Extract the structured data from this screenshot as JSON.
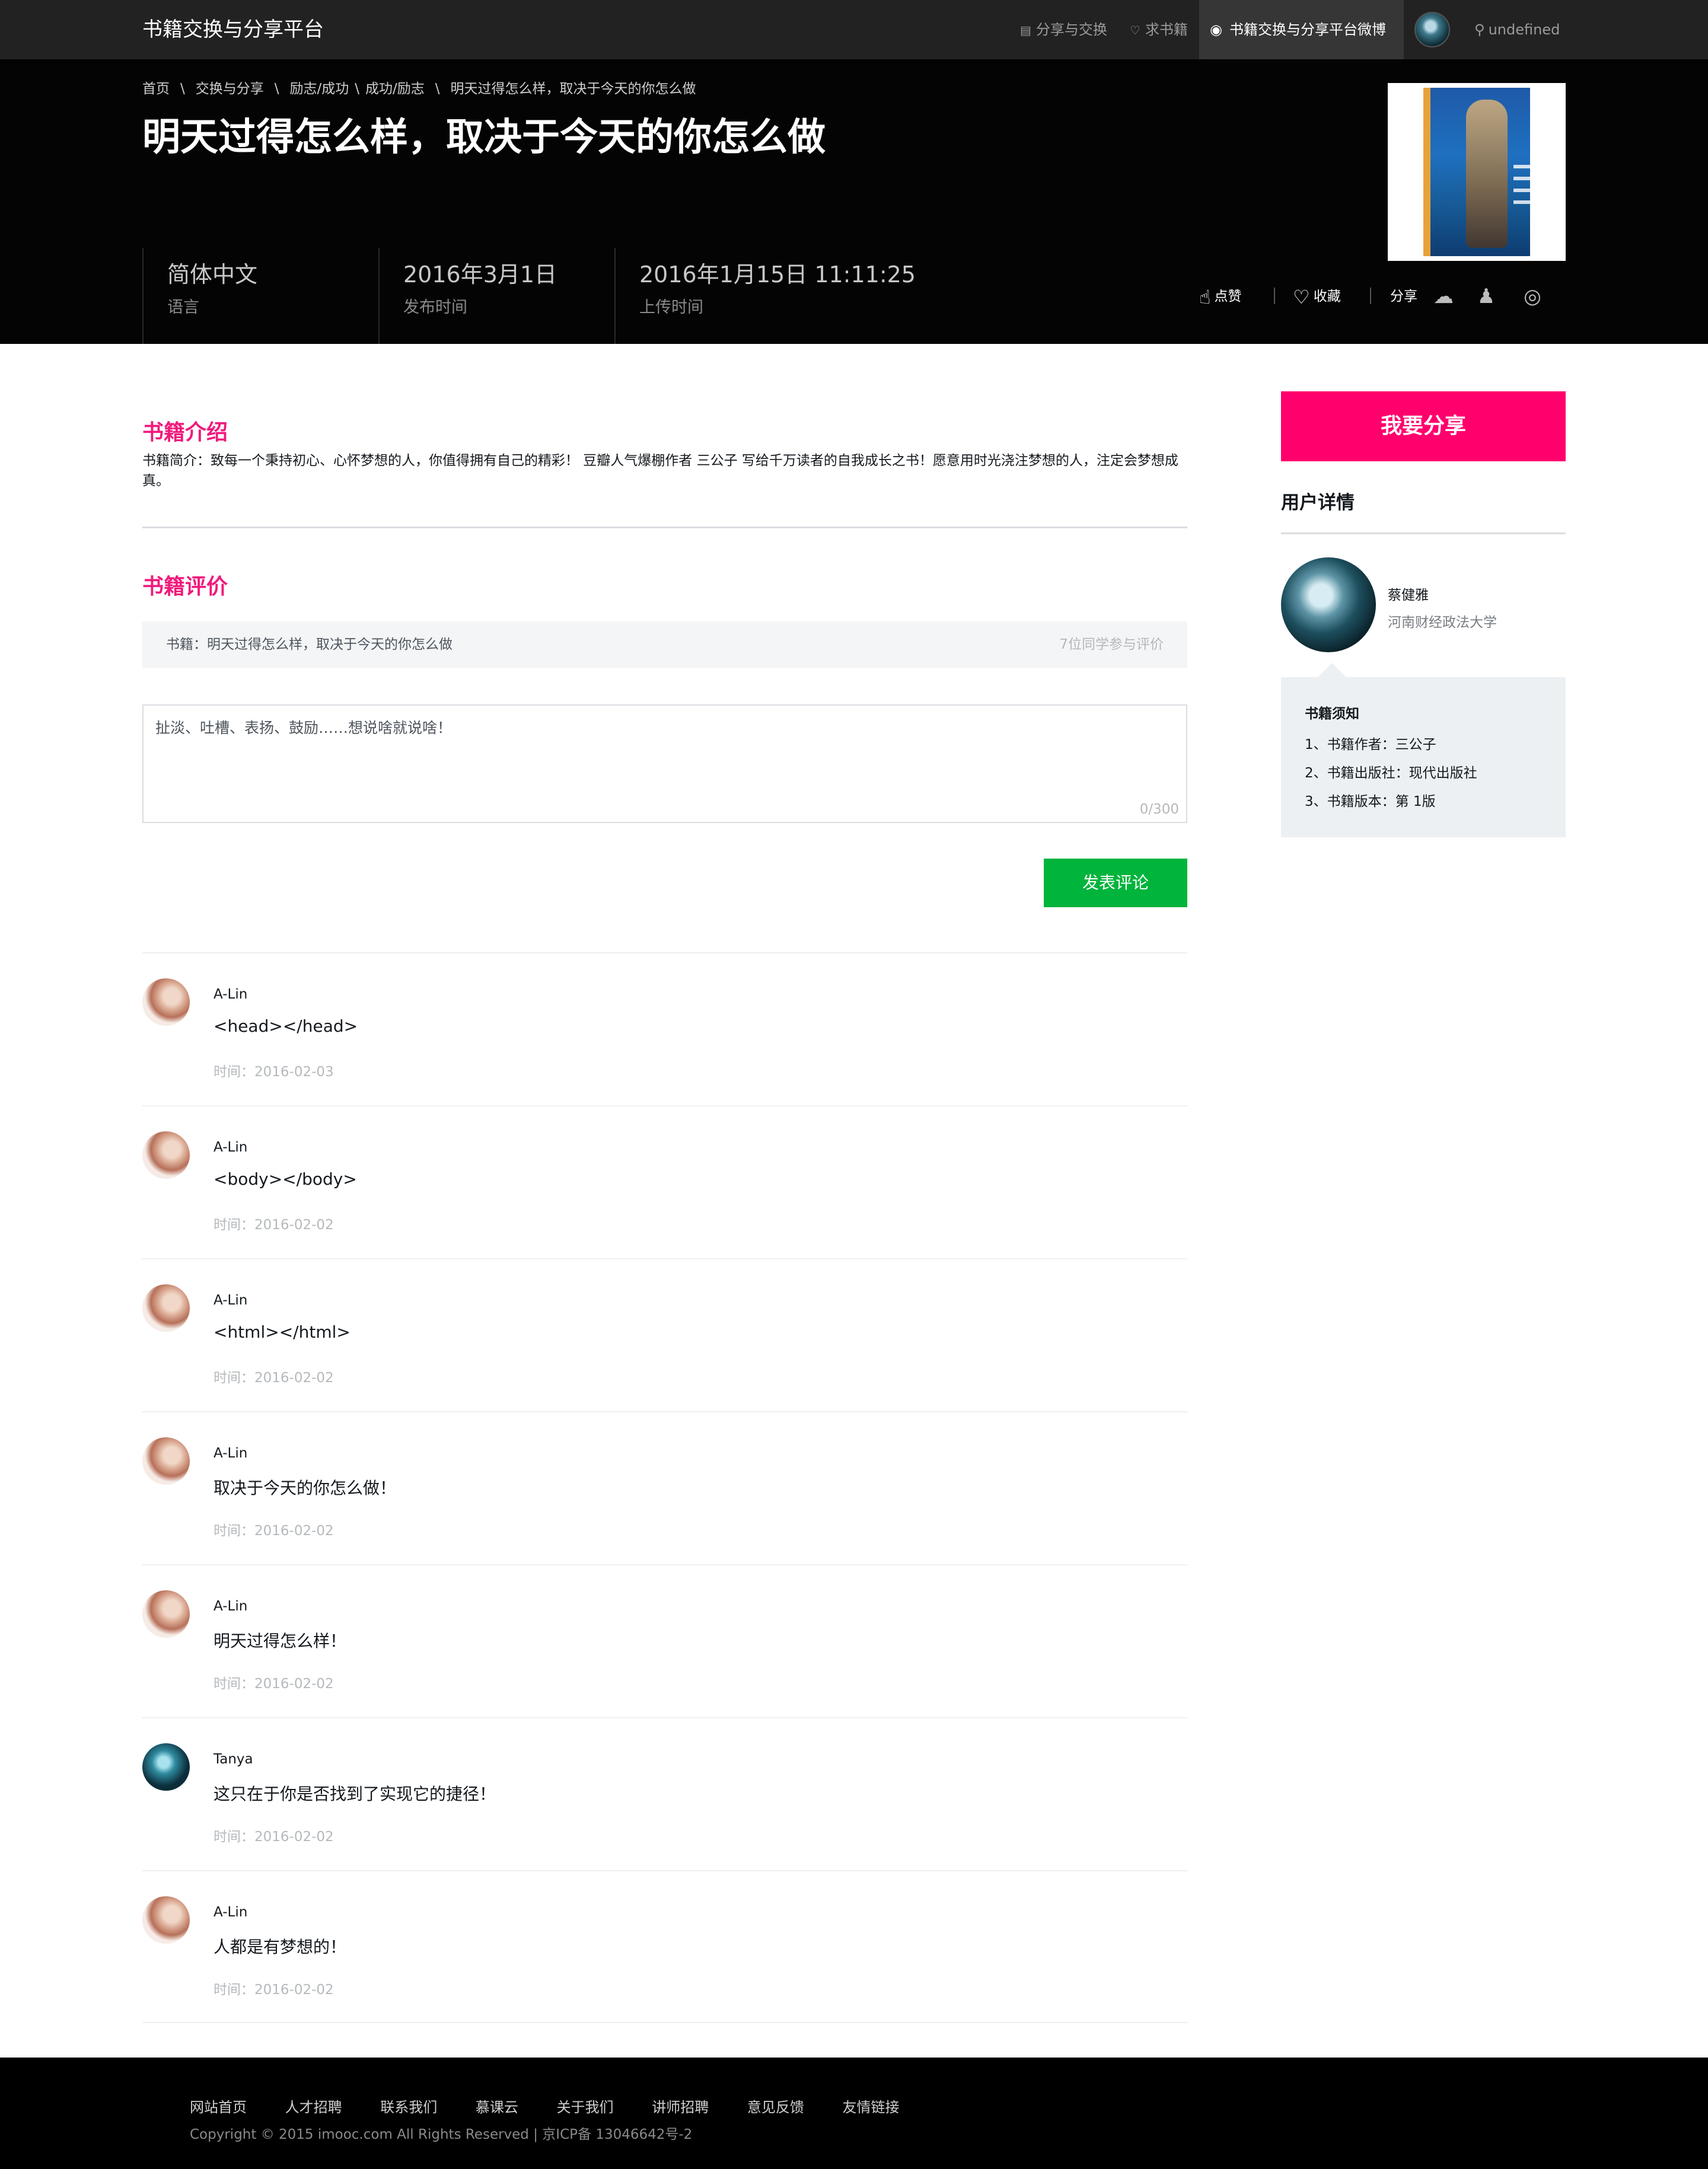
{
  "nav": {
    "brand": "书籍交换与分享平台",
    "links": [
      "分享与交换",
      "求书籍"
    ],
    "weibo": "书籍交换与分享平台微博",
    "location": "undefined"
  },
  "header": {
    "breadcrumbs": [
      "首页",
      "交换与分享",
      "励志/成功",
      "成功/励志",
      "明天过得怎么样，取决于今天的你怎么做"
    ],
    "title": "明天过得怎么样，取决于今天的你怎么做",
    "meta": [
      {
        "value": "简体中文",
        "label": "语言"
      },
      {
        "value": "2016年3月1日",
        "label": "发布时间"
      },
      {
        "value": "2016年1月15日 11:11:25",
        "label": "上传时间"
      }
    ],
    "actions": {
      "like": "点赞",
      "favorite": "收藏",
      "share": "分享"
    }
  },
  "intro": {
    "title": "书籍介绍",
    "text": "书籍简介：致每一个秉持初心、心怀梦想的人，你值得拥有自己的精彩！ 豆瓣人气爆棚作者 三公子 写给千万读者的自我成长之书！愿意用时光浇注梦想的人，注定会梦想成真。"
  },
  "review": {
    "title": "书籍评价",
    "book_label": "书籍：明天过得怎么样，取决于今天的你怎么做",
    "participants": "7位同学参与评价",
    "placeholder": "扯淡、吐槽、表扬、鼓励……想说啥就说啥！",
    "counter": "0/300",
    "submit": "发表评论"
  },
  "comments": [
    {
      "user": "A-Lin",
      "text": "<head></head>",
      "time": "时间：2016-02-03",
      "avatar": "alin"
    },
    {
      "user": "A-Lin",
      "text": "<body></body>",
      "time": "时间：2016-02-02",
      "avatar": "alin"
    },
    {
      "user": "A-Lin",
      "text": "<html></html>",
      "time": "时间：2016-02-02",
      "avatar": "alin"
    },
    {
      "user": "A-Lin",
      "text": "取决于今天的你怎么做！",
      "time": "时间：2016-02-02",
      "avatar": "alin"
    },
    {
      "user": "A-Lin",
      "text": "明天过得怎么样！",
      "time": "时间：2016-02-02",
      "avatar": "alin"
    },
    {
      "user": "Tanya",
      "text": "这只在于你是否找到了实现它的捷径！",
      "time": "时间：2016-02-02",
      "avatar": "tanya"
    },
    {
      "user": "A-Lin",
      "text": "人都是有梦想的！",
      "time": "时间：2016-02-02",
      "avatar": "alin"
    }
  ],
  "sidebar": {
    "share_button": "我要分享",
    "user_title": "用户详情",
    "user_name": "蔡健雅",
    "user_school": "河南财经政法大学",
    "notice_title": "书籍须知",
    "notice_items": [
      "1、书籍作者：三公子",
      "2、书籍出版社：现代出版社",
      "3、书籍版本：第 1版"
    ]
  },
  "footer": {
    "links": [
      "网站首页",
      "人才招聘",
      "联系我们",
      "慕课云",
      "关于我们",
      "讲师招聘",
      "意见反馈",
      "友情链接"
    ],
    "copyright": "Copyright © 2015 imooc.com All Rights Reserved | 京ICP备 13046642号-2"
  },
  "colors": {
    "accent": "#f01a7c",
    "share_button": "#ff006d",
    "submit": "#00b43c",
    "nav": "#222222"
  }
}
